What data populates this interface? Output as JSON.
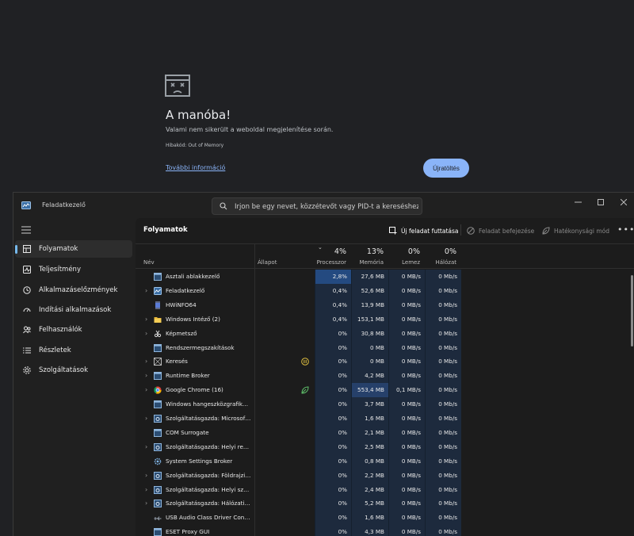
{
  "chrome_error": {
    "title": "A manóba!",
    "message": "Valami nem sikerült a weboldal megjelenítése során.",
    "error_code": "Hibakód: Out of Memory",
    "more_info_link": "További információ",
    "reload_button": "Újratöltés"
  },
  "taskmgr": {
    "window_title": "Feladatkezelő",
    "search_placeholder": "Írjon be egy nevet, közzétevőt vagy PID-t a kereséshez",
    "sidebar": [
      {
        "label": "Folyamatok",
        "icon": "processes-icon",
        "active": true
      },
      {
        "label": "Teljesítmény",
        "icon": "performance-icon"
      },
      {
        "label": "Alkalmazáselőzmények",
        "icon": "history-icon"
      },
      {
        "label": "Indítási alkalmazások",
        "icon": "startup-icon"
      },
      {
        "label": "Felhasználók",
        "icon": "users-icon"
      },
      {
        "label": "Részletek",
        "icon": "details-icon"
      },
      {
        "label": "Szolgáltatások",
        "icon": "services-icon"
      }
    ],
    "page_title": "Folyamatok",
    "commands": {
      "new_task": "Új feladat futtatása",
      "end_task": "Feladat befejezése",
      "efficiency": "Hatékonysági mód"
    },
    "columns": {
      "name": "Név",
      "status": "Állapot",
      "cpu": {
        "label": "Processzor",
        "total": "4%"
      },
      "memory": {
        "label": "Memória",
        "total": "13%"
      },
      "disk": {
        "label": "Lemez",
        "total": "0%"
      },
      "network": {
        "label": "Hálózat",
        "total": "0%"
      }
    },
    "processes": [
      {
        "name": "Asztali ablakkezelő",
        "expand": false,
        "icon": "window-icon",
        "cpu": "2,8%",
        "mem": "27,6 MB",
        "disk": "0 MB/s",
        "net": "0 Mb/s",
        "status": ""
      },
      {
        "name": "Feladatkezelő",
        "expand": true,
        "icon": "taskmgr-icon",
        "cpu": "0,4%",
        "mem": "52,6 MB",
        "disk": "0 MB/s",
        "net": "0 Mb/s",
        "status": ""
      },
      {
        "name": "HWiNFO64",
        "expand": false,
        "icon": "chip-icon",
        "cpu": "0,4%",
        "mem": "13,9 MB",
        "disk": "0 MB/s",
        "net": "0 Mb/s",
        "status": ""
      },
      {
        "name": "Windows Intéző (2)",
        "expand": true,
        "icon": "folder-icon",
        "cpu": "0,4%",
        "mem": "153,1 MB",
        "disk": "0 MB/s",
        "net": "0 Mb/s",
        "status": ""
      },
      {
        "name": "Képmetsző",
        "expand": true,
        "icon": "snip-icon",
        "cpu": "0%",
        "mem": "30,8 MB",
        "disk": "0 MB/s",
        "net": "0 Mb/s",
        "status": ""
      },
      {
        "name": "Rendszermegszakítások",
        "expand": false,
        "icon": "window-icon",
        "cpu": "0%",
        "mem": "0 MB",
        "disk": "0 MB/s",
        "net": "0 Mb/s",
        "status": ""
      },
      {
        "name": "Keresés",
        "expand": true,
        "icon": "search-box-icon",
        "cpu": "0%",
        "mem": "0 MB",
        "disk": "0 MB/s",
        "net": "0 Mb/s",
        "status": "paused"
      },
      {
        "name": "Runtime Broker",
        "expand": true,
        "icon": "window-icon",
        "cpu": "0%",
        "mem": "4,2 MB",
        "disk": "0 MB/s",
        "net": "0 Mb/s",
        "status": ""
      },
      {
        "name": "Google Chrome (16)",
        "expand": true,
        "icon": "chrome-icon",
        "cpu": "0%",
        "mem": "553,4 MB",
        "disk": "0,1 MB/s",
        "net": "0 Mb/s",
        "status": "efficiency"
      },
      {
        "name": "Windows hangeszközgrafikon...",
        "expand": false,
        "icon": "window-icon",
        "cpu": "0%",
        "mem": "3,7 MB",
        "disk": "0 MB/s",
        "net": "0 Mb/s",
        "status": ""
      },
      {
        "name": "Szolgáltatásgazda: Microsoft P...",
        "expand": true,
        "icon": "gear-icon",
        "cpu": "0%",
        "mem": "1,6 MB",
        "disk": "0 MB/s",
        "net": "0 Mb/s",
        "status": ""
      },
      {
        "name": "COM Surrogate",
        "expand": false,
        "icon": "window-icon",
        "cpu": "0%",
        "mem": "2,1 MB",
        "disk": "0 MB/s",
        "net": "0 Mb/s",
        "status": ""
      },
      {
        "name": "Szolgáltatásgazda: Helyi rends...",
        "expand": true,
        "icon": "gear-icon",
        "cpu": "0%",
        "mem": "2,5 MB",
        "disk": "0 MB/s",
        "net": "0 Mb/s",
        "status": ""
      },
      {
        "name": "System Settings Broker",
        "expand": false,
        "icon": "settings-icon",
        "cpu": "0%",
        "mem": "0,8 MB",
        "disk": "0 MB/s",
        "net": "0 Mb/s",
        "status": ""
      },
      {
        "name": "Szolgáltatásgazda: Földrajzi H...",
        "expand": true,
        "icon": "gear-icon",
        "cpu": "0%",
        "mem": "2,2 MB",
        "disk": "0 MB/s",
        "net": "0 Mb/s",
        "status": ""
      },
      {
        "name": "Szolgáltatásgazda: Helyi szolg...",
        "expand": true,
        "icon": "gear-icon",
        "cpu": "0%",
        "mem": "2,4 MB",
        "disk": "0 MB/s",
        "net": "0 Mb/s",
        "status": ""
      },
      {
        "name": "Szolgáltatásgazda: Hálózati sz...",
        "expand": true,
        "icon": "gear-icon",
        "cpu": "0%",
        "mem": "5,2 MB",
        "disk": "0 MB/s",
        "net": "0 Mb/s",
        "status": ""
      },
      {
        "name": "USB Audio Class Driver Contro...",
        "expand": false,
        "icon": "usb-icon",
        "cpu": "0%",
        "mem": "1,6 MB",
        "disk": "0 MB/s",
        "net": "0 Mb/s",
        "status": ""
      },
      {
        "name": "ESET Proxy GUI",
        "expand": false,
        "icon": "window-icon",
        "cpu": "0%",
        "mem": "4,3 MB",
        "disk": "0 MB/s",
        "net": "0 Mb/s",
        "status": ""
      }
    ]
  }
}
